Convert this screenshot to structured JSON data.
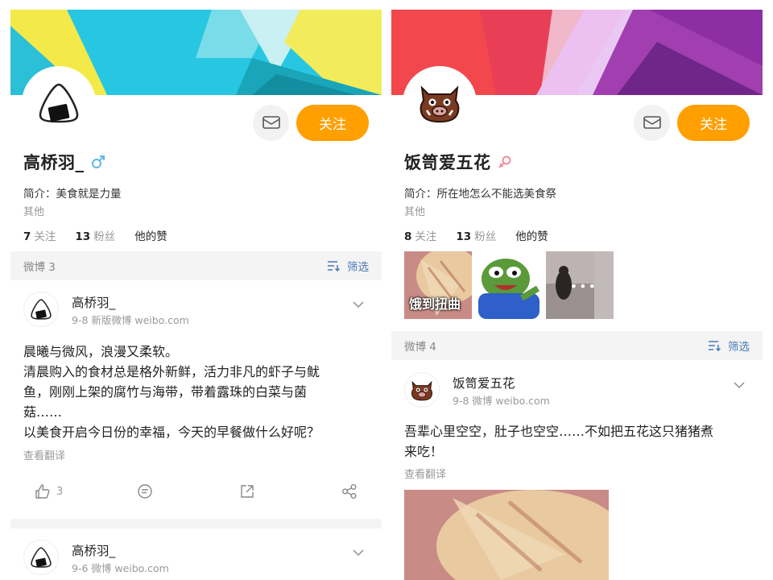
{
  "left": {
    "profile": {
      "name": "高桥羽_",
      "bio": "简介：美食就是力量",
      "other": "其他",
      "following_count": "7",
      "following_label": "关注",
      "fans_count": "13",
      "fans_label": "粉丝",
      "likes_label": "他的赞"
    },
    "buttons": {
      "follow": "关注"
    },
    "feed_bar": {
      "label": "微博 3",
      "filter": "筛选"
    },
    "post1": {
      "author": "高桥羽_",
      "meta": "9-8   新版微博 weibo.com",
      "lines": [
        "晨曦与微风，浪漫又柔软。",
        "清晨购入的食材总是格外新鲜，活力非凡的虾子与鱿",
        "鱼，刚刚上架的腐竹与海带，带着露珠的白菜与菌",
        "菇……",
        "以美食开启今日份的幸福，今天的早餐做什么好呢？"
      ],
      "translate": "查看翻译",
      "like_count": "3"
    },
    "post2": {
      "author": "高桥羽_",
      "meta": "9-6   微博 weibo.com"
    }
  },
  "right": {
    "profile": {
      "name": "饭笥爱五花",
      "bio": "简介：所在地怎么不能选美食祭",
      "other": "其他",
      "following_count": "8",
      "following_label": "关注",
      "fans_count": "13",
      "fans_label": "粉丝",
      "likes_label": "他的赞"
    },
    "buttons": {
      "follow": "关注"
    },
    "stickers": {
      "caption": "饿到扭曲",
      "dots": "•••"
    },
    "feed_bar": {
      "label": "微博 4",
      "filter": "筛选"
    },
    "post1": {
      "author": "饭笥爱五花",
      "meta": "9-8   微博 weibo.com",
      "lines": [
        "吾辈心里空空，肚子也空空……不如把五花这只猪猪煮",
        "来吃！"
      ],
      "translate": "查看翻译"
    }
  },
  "colors": {
    "follow_orange": "#ff9f00",
    "filter_blue": "#4a7ab8",
    "male_blue": "#5fb6e6",
    "female_pink": "#f28b9c"
  },
  "icons": [
    "mail-icon",
    "male-icon",
    "female-icon",
    "filter-icon",
    "chevron-down-icon",
    "like-icon",
    "comment-icon",
    "repost-icon",
    "share-icon"
  ]
}
